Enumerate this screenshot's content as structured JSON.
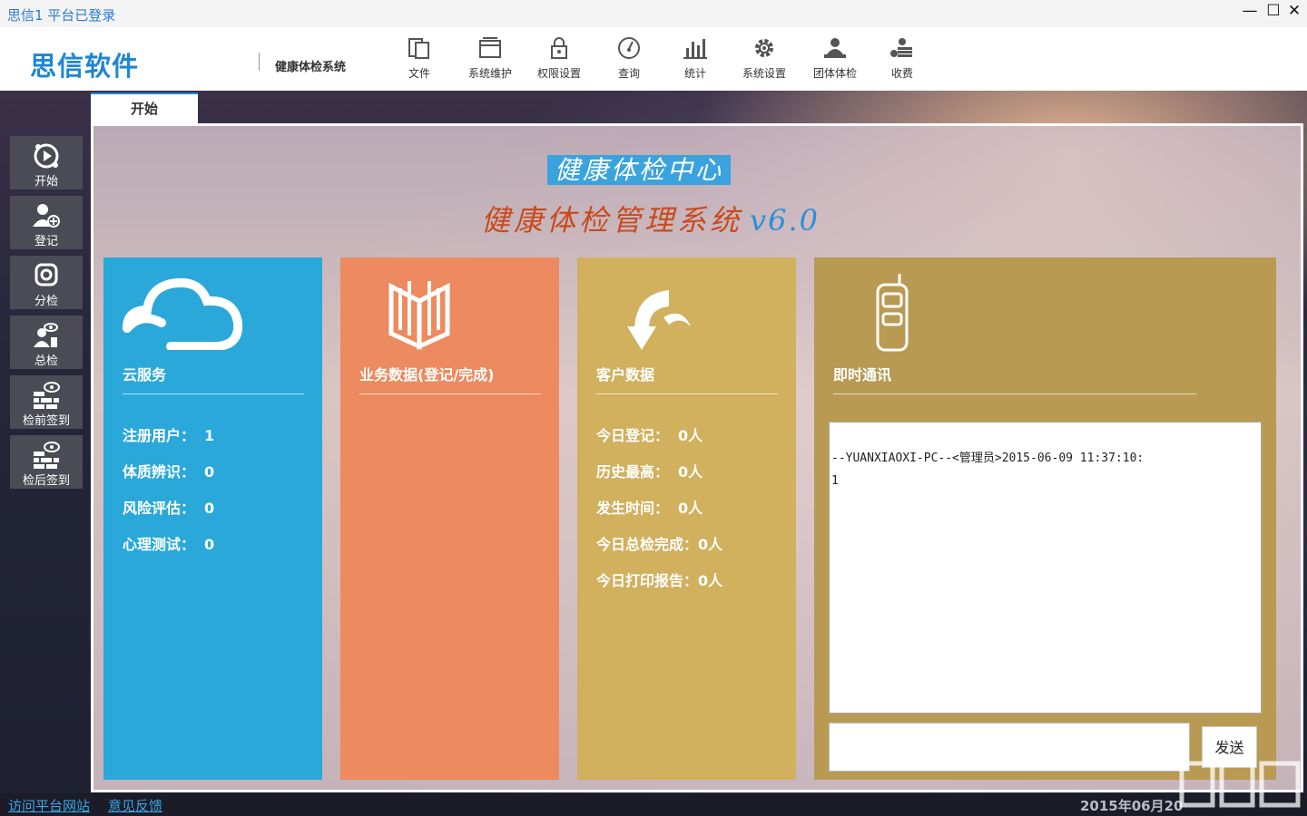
{
  "window": {
    "title": "思信1 平台已登录",
    "minimize": "—",
    "maximize": "☐",
    "close": "✕"
  },
  "header": {
    "brand": "思信软件",
    "subtitle": "健康体检系统",
    "toolbar": [
      {
        "label": "文件",
        "icon": "file-icon"
      },
      {
        "label": "系统维护",
        "icon": "maintenance-icon"
      },
      {
        "label": "权限设置",
        "icon": "lock-icon"
      },
      {
        "label": "查询",
        "icon": "gauge-icon"
      },
      {
        "label": "统计",
        "icon": "bar-chart-icon"
      },
      {
        "label": "系统设置",
        "icon": "gear-icon"
      },
      {
        "label": "团体体检",
        "icon": "group-user-icon"
      },
      {
        "label": "收费",
        "icon": "coins-icon"
      }
    ]
  },
  "sidebar": {
    "items": [
      {
        "label": "开始",
        "icon": "start-play-icon"
      },
      {
        "label": "登记",
        "icon": "add-user-icon"
      },
      {
        "label": "分检",
        "icon": "disc-icon"
      },
      {
        "label": "总检",
        "icon": "eye-user-icon"
      },
      {
        "label": "检前签到",
        "icon": "eye-brick-icon"
      },
      {
        "label": "检后签到",
        "icon": "eye-brick-icon"
      }
    ]
  },
  "tabs": [
    {
      "label": "开始",
      "active": true
    }
  ],
  "main": {
    "center_title": "健康体检中心",
    "system_title": "健康体检管理系统",
    "version": "v6.0",
    "tiles": {
      "cloud": {
        "title": "云服务",
        "color": "#2aa8da",
        "icon": "cloud-icon",
        "rows": [
          {
            "label": "注册用户：",
            "value": "1"
          },
          {
            "label": "体质辨识：",
            "value": "0"
          },
          {
            "label": "风险评估：",
            "value": "0"
          },
          {
            "label": "心理测试：",
            "value": "0"
          }
        ]
      },
      "business": {
        "title": "业务数据(登记/完成)",
        "color": "#ed8a5f",
        "icon": "book-icon"
      },
      "customer": {
        "title": "客户数据",
        "color": "#d1b05e",
        "icon": "return-arrow-icon",
        "rows": [
          {
            "label": "今日登记：",
            "value": "0人"
          },
          {
            "label": "历史最高：",
            "value": "0人"
          },
          {
            "label": "发生时间：",
            "value": "0人"
          },
          {
            "label": "今日总检完成：",
            "value": "0人"
          },
          {
            "label": "今日打印报告：",
            "value": "0人"
          }
        ]
      },
      "im": {
        "title": "即时通讯",
        "color": "#b89a52",
        "icon": "mobile-phone-icon",
        "messages": [
          "--YUANXIAOXI-PC--<管理员>2015-06-09 11:37:10:",
          "1"
        ],
        "input_value": "",
        "send_label": "发送"
      }
    }
  },
  "status": {
    "links": [
      "访问平台网站",
      "意见反馈"
    ],
    "date": "2015年06月20"
  }
}
